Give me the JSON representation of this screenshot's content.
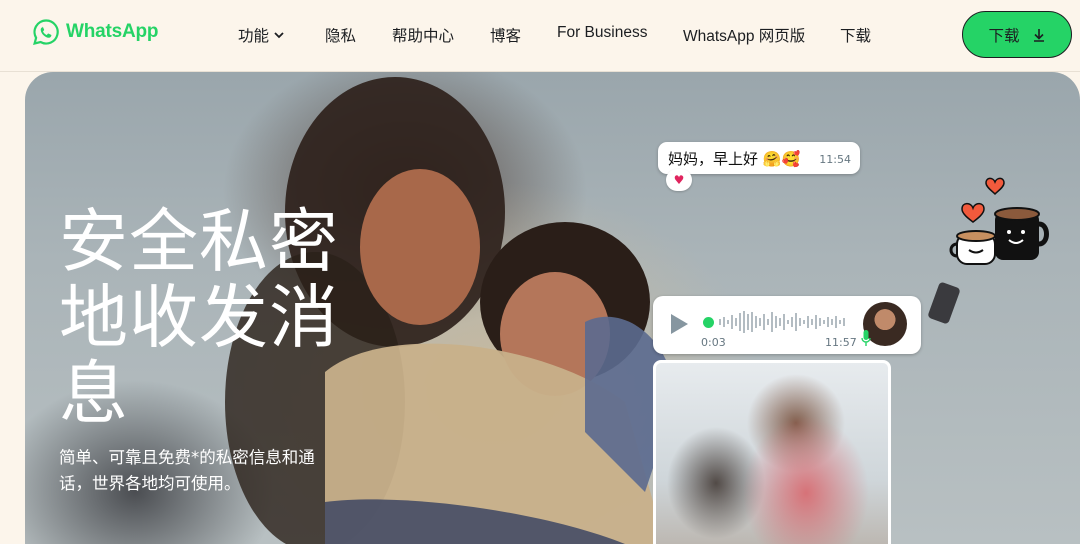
{
  "header": {
    "logo_text": "WhatsApp",
    "nav": [
      {
        "label": "功能",
        "has_dropdown": true
      },
      {
        "label": "隐私"
      },
      {
        "label": "帮助中心"
      },
      {
        "label": "博客"
      },
      {
        "label": "For Business"
      },
      {
        "label": "WhatsApp 网页版"
      },
      {
        "label": "下载"
      }
    ],
    "download_button": {
      "label": "下载",
      "icon": "download-arrow-icon"
    }
  },
  "hero": {
    "title": "安全私密地收发消息",
    "subtitle": "简单、可靠且免费*的私密信息和通话，世界各地均可使用。",
    "chat_bubble": {
      "text": "妈妈，早上好 🤗🥰",
      "time": "11:54",
      "reaction": "♥"
    },
    "voice_note": {
      "elapsed": "0:03",
      "time": "11:57"
    }
  },
  "colors": {
    "brand_green": "#25d366",
    "page_bg": "#fcf5eb",
    "text_dark": "#1c1e21"
  }
}
